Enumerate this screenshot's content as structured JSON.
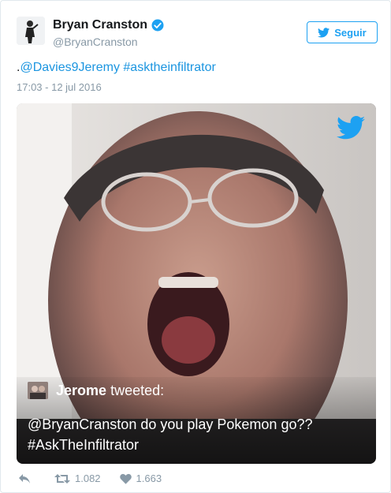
{
  "author": {
    "name": "Bryan Cranston",
    "handle": "@BryanCranston",
    "verified": true
  },
  "follow_button": {
    "label": "Seguir",
    "icon": "twitter-bird-icon"
  },
  "tweet": {
    "text_prefix": ".",
    "mention": "@Davies9Jeremy",
    "hashtag": "#asktheinfiltrator",
    "timestamp": "17:03 - 12 jul 2016"
  },
  "media": {
    "logo_icon": "twitter-bird-icon",
    "quoted": {
      "author": "Jerome",
      "verb": "tweeted:",
      "text": "@BryanCranston do you play Pokemon go?? #AskTheInfiltrator"
    }
  },
  "actions": {
    "reply_icon": "reply-icon",
    "retweet_icon": "retweet-icon",
    "retweet_count": "1.082",
    "like_icon": "heart-icon",
    "like_count": "1.663"
  },
  "colors": {
    "accent": "#1da1f2",
    "link": "#1b95e0",
    "muted": "#8899a6"
  }
}
